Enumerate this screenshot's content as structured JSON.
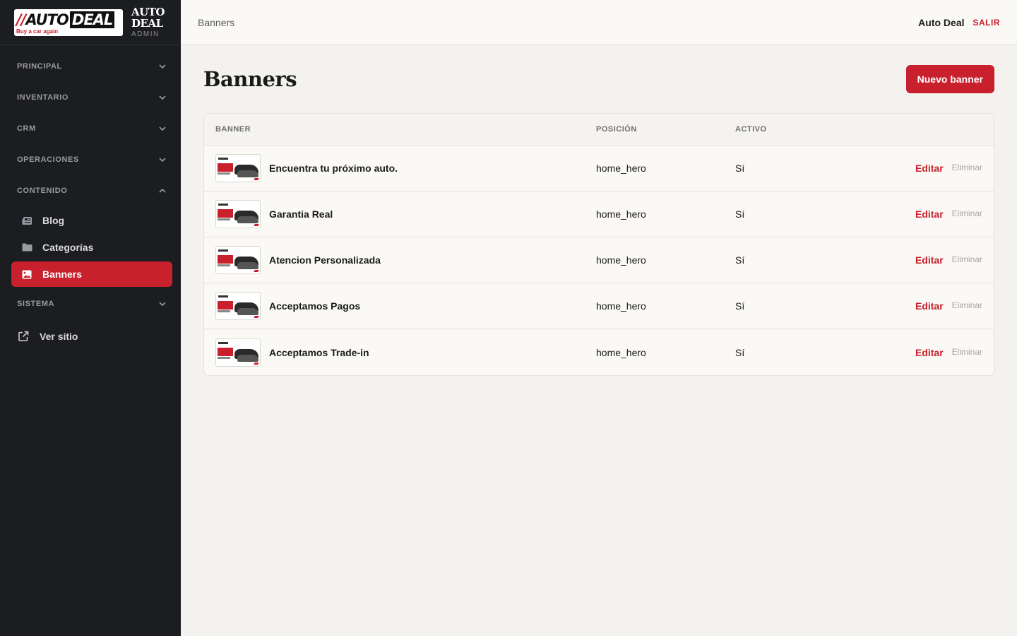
{
  "brand": {
    "logo_slash": "//",
    "logo_auto": "AUTO",
    "logo_deal": "DEAL",
    "logo_tagline": "Buy a car again",
    "title": "AUTO DEAL",
    "subtitle": "ADMIN"
  },
  "sidebar": {
    "sections": [
      {
        "label": "PRINCIPAL",
        "expanded": false
      },
      {
        "label": "INVENTARIO",
        "expanded": false
      },
      {
        "label": "CRM",
        "expanded": false
      },
      {
        "label": "OPERACIONES",
        "expanded": false
      },
      {
        "label": "CONTENIDO",
        "expanded": true
      },
      {
        "label": "SISTEMA",
        "expanded": false
      }
    ],
    "contenido_items": [
      {
        "label": "Blog",
        "icon": "newspaper-icon",
        "active": false
      },
      {
        "label": "Categorías",
        "icon": "folder-icon",
        "active": false
      },
      {
        "label": "Banners",
        "icon": "image-icon",
        "active": true
      }
    ],
    "ver_sitio": "Ver sitio"
  },
  "topbar": {
    "breadcrumb": "Banners",
    "user_name": "Auto Deal",
    "logout_label": "SALIR"
  },
  "page": {
    "title": "Banners",
    "new_button": "Nuevo banner"
  },
  "table": {
    "headers": {
      "banner": "BANNER",
      "position": "POSICIÓN",
      "active": "ACTIVO"
    },
    "edit_label": "Editar",
    "delete_label": "Eliminar",
    "rows": [
      {
        "name": "Encuentra tu próximo auto.",
        "position": "home_hero",
        "active": "Sí"
      },
      {
        "name": "Garantia Real",
        "position": "home_hero",
        "active": "Sí"
      },
      {
        "name": "Atencion Personalizada",
        "position": "home_hero",
        "active": "Sí"
      },
      {
        "name": "Acceptamos Pagos",
        "position": "home_hero",
        "active": "Sí"
      },
      {
        "name": "Acceptamos Trade-in",
        "position": "home_hero",
        "active": "Sí"
      }
    ]
  },
  "colors": {
    "accent": "#c8202c",
    "sidebar_bg": "#1c1d21",
    "page_bg": "#f3f2ef"
  }
}
